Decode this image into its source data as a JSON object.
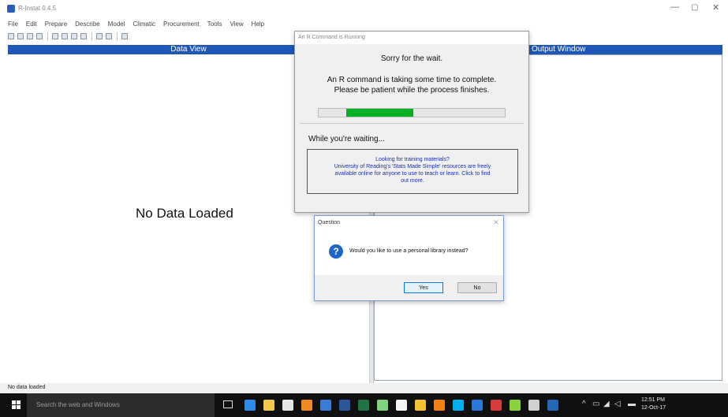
{
  "app": {
    "title": "R-Instat 0.4.5",
    "window_controls": {
      "minimize": "—",
      "maximize": "▢",
      "close": "✕"
    }
  },
  "menubar": {
    "items": [
      "File",
      "Edit",
      "Prepare",
      "Describe",
      "Model",
      "Climatic",
      "Procurement",
      "Tools",
      "View",
      "Help"
    ]
  },
  "toolbar": {
    "icons": [
      "new-icon",
      "open-icon",
      "save-icon",
      "print-icon",
      "cut-icon",
      "copy-icon",
      "paste-icon",
      "output-icon",
      "grid-icon",
      "dropdown-icon",
      "help-icon"
    ]
  },
  "panes": {
    "data_view_title": "Data View",
    "output_title": "Output Window",
    "no_data_text": "No Data Loaded"
  },
  "r_dialog": {
    "title": "An R Command is Running",
    "sorry": "Sorry for the wait.",
    "message_line1": "An R command is taking some time to complete.",
    "message_line2": "Please be patient while the process finishes.",
    "progress": 0.36,
    "progress_color": "#06b025",
    "waiting_label": "While you're waiting...",
    "info_line1": "Looking for training materials?",
    "info_line2": "University of Reading's 'Stats Made Simple' resources are freely",
    "info_line3": "available online for anyone to use to teach or learn. Click to find",
    "info_line4": "out more."
  },
  "question_dialog": {
    "title": "Question",
    "icon": "question-icon",
    "text": "Would you like to use a personal library instead?",
    "yes_label": "Yes",
    "no_label": "No"
  },
  "status": {
    "text": "No data loaded"
  },
  "taskbar": {
    "search_placeholder": "Search the web and Windows",
    "clock_time": "12:51 PM",
    "clock_date": "12-Oct-17",
    "apps": [
      {
        "name": "edge-icon",
        "color": "#2f8be6"
      },
      {
        "name": "file-explorer-icon",
        "color": "#f2c94c"
      },
      {
        "name": "store-icon",
        "color": "#e6e6e6"
      },
      {
        "name": "firefox-icon",
        "color": "#f08a24"
      },
      {
        "name": "chrome-icon",
        "color": "#3a7bd5"
      },
      {
        "name": "word-icon",
        "color": "#2b579a"
      },
      {
        "name": "excel-icon",
        "color": "#217346"
      },
      {
        "name": "app-green-icon",
        "color": "#7fd37f"
      },
      {
        "name": "notepad-icon",
        "color": "#f5f5f5"
      },
      {
        "name": "app-yellow-icon",
        "color": "#f2c230"
      },
      {
        "name": "vlc-icon",
        "color": "#f08010"
      },
      {
        "name": "skype-icon",
        "color": "#00aff0"
      },
      {
        "name": "app-blue-icon",
        "color": "#2c78d8"
      },
      {
        "name": "app-red-icon",
        "color": "#d83b3b"
      },
      {
        "name": "app-lime-icon",
        "color": "#8bd33c"
      },
      {
        "name": "photos-icon",
        "color": "#d0d0d0"
      },
      {
        "name": "r-icon",
        "color": "#2467b8"
      }
    ]
  }
}
